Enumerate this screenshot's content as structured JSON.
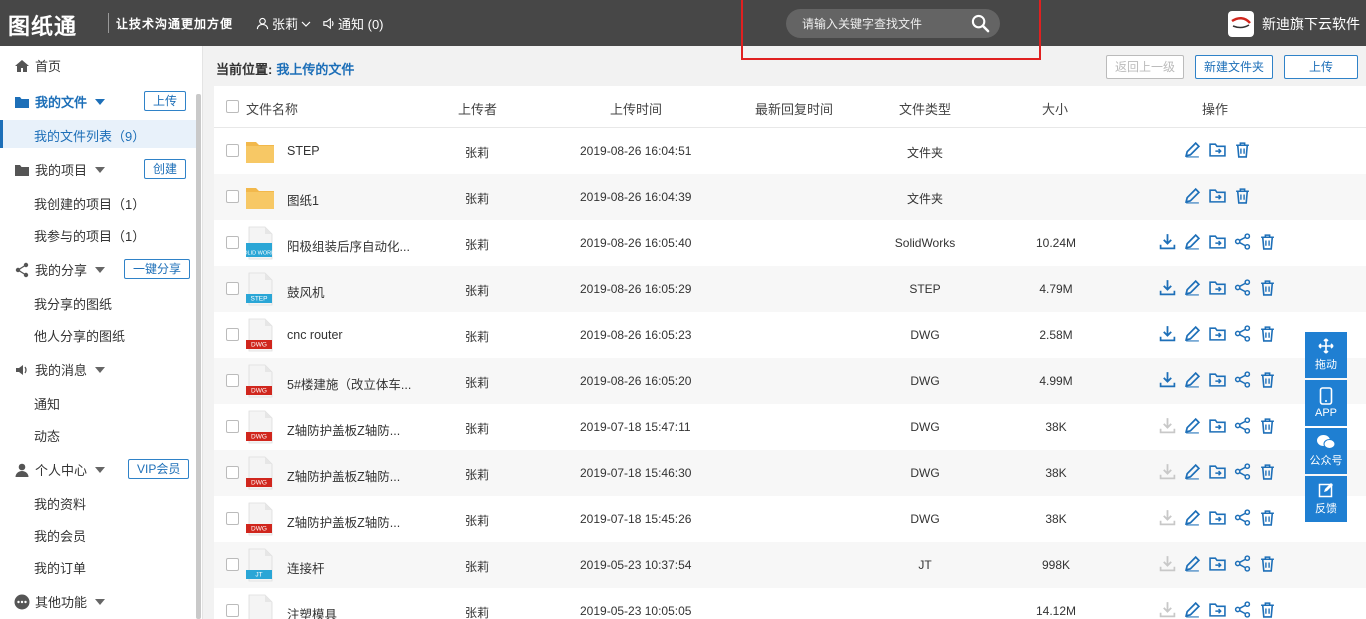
{
  "header": {
    "logo": "图纸通",
    "slogan": "让技术沟通更加方便",
    "user_name": "张莉",
    "notice_label": "通知 (0)",
    "search_placeholder": "请输入关键字查找文件",
    "brand": "新迪旗下云软件"
  },
  "sidebar": {
    "home": "首页",
    "my_files": "我的文件",
    "upload_btn": "上传",
    "file_list": "我的文件列表（9）",
    "my_projects": "我的项目",
    "create_btn": "创建",
    "created_projects": "我创建的项目（1）",
    "joined_projects": "我参与的项目（1）",
    "my_shares": "我的分享",
    "share_btn": "一键分享",
    "shared_by_me": "我分享的图纸",
    "shared_by_others": "他人分享的图纸",
    "my_messages": "我的消息",
    "notice": "通知",
    "activity": "动态",
    "personal": "个人中心",
    "vip_btn": "VIP会员",
    "my_profile": "我的资料",
    "my_membership": "我的会员",
    "my_orders": "我的订单",
    "more": "其他功能"
  },
  "breadcrumb": {
    "label": "当前位置:",
    "current": "我上传的文件"
  },
  "toolbar": {
    "back": "返回上一级",
    "new_folder": "新建文件夹",
    "upload": "上传"
  },
  "table": {
    "headers": [
      "文件名称",
      "上传者",
      "上传时间",
      "最新回复时间",
      "文件类型",
      "大小",
      "操作"
    ],
    "rows": [
      {
        "name": "STEP",
        "uploader": "张莉",
        "time": "2019-08-26 16:04:51",
        "type": "文件夹",
        "size": "",
        "icon": "folder",
        "badge": ""
      },
      {
        "name": "图纸1",
        "uploader": "张莉",
        "time": "2019-08-26 16:04:39",
        "type": "文件夹",
        "size": "",
        "icon": "folder",
        "badge": ""
      },
      {
        "name": "阳极组装后序自动化...",
        "uploader": "张莉",
        "time": "2019-08-26 16:05:40",
        "type": "SolidWorks",
        "size": "10.24M",
        "icon": "solidworks",
        "badge": "SOLID WORKS"
      },
      {
        "name": "鼓风机",
        "uploader": "张莉",
        "time": "2019-08-26 16:05:29",
        "type": "STEP",
        "size": "4.79M",
        "icon": "step",
        "badge": "STEP"
      },
      {
        "name": "cnc router",
        "uploader": "张莉",
        "time": "2019-08-26 16:05:23",
        "type": "DWG",
        "size": "2.58M",
        "icon": "dwg",
        "badge": "DWG"
      },
      {
        "name": "5#楼建施（改立体车...",
        "uploader": "张莉",
        "time": "2019-08-26 16:05:20",
        "type": "DWG",
        "size": "4.99M",
        "icon": "dwg",
        "badge": "DWG"
      },
      {
        "name": "Z轴防护盖板Z轴防...",
        "uploader": "张莉",
        "time": "2019-07-18 15:47:11",
        "type": "DWG",
        "size": "38K",
        "icon": "dwg",
        "badge": "DWG"
      },
      {
        "name": "Z轴防护盖板Z轴防...",
        "uploader": "张莉",
        "time": "2019-07-18 15:46:30",
        "type": "DWG",
        "size": "38K",
        "icon": "dwg",
        "badge": "DWG"
      },
      {
        "name": "Z轴防护盖板Z轴防...",
        "uploader": "张莉",
        "time": "2019-07-18 15:45:26",
        "type": "DWG",
        "size": "38K",
        "icon": "dwg",
        "badge": "DWG"
      },
      {
        "name": "连接杆",
        "uploader": "张莉",
        "time": "2019-05-23 10:37:54",
        "type": "JT",
        "size": "998K",
        "icon": "jt",
        "badge": "JT"
      },
      {
        "name": "注塑模具",
        "uploader": "张莉",
        "time": "2019-05-23 10:05:05",
        "type": "",
        "size": "14.12M",
        "icon": "blank",
        "badge": ""
      }
    ]
  },
  "float_bar": {
    "drag": "拖动",
    "app": "APP",
    "wechat": "公众号",
    "feedback": "反馈"
  },
  "colors": {
    "accent": "#1d6fb8",
    "header_bg": "#474747",
    "dwg_red": "#d0261d",
    "step_blue": "#2aa6d6"
  }
}
